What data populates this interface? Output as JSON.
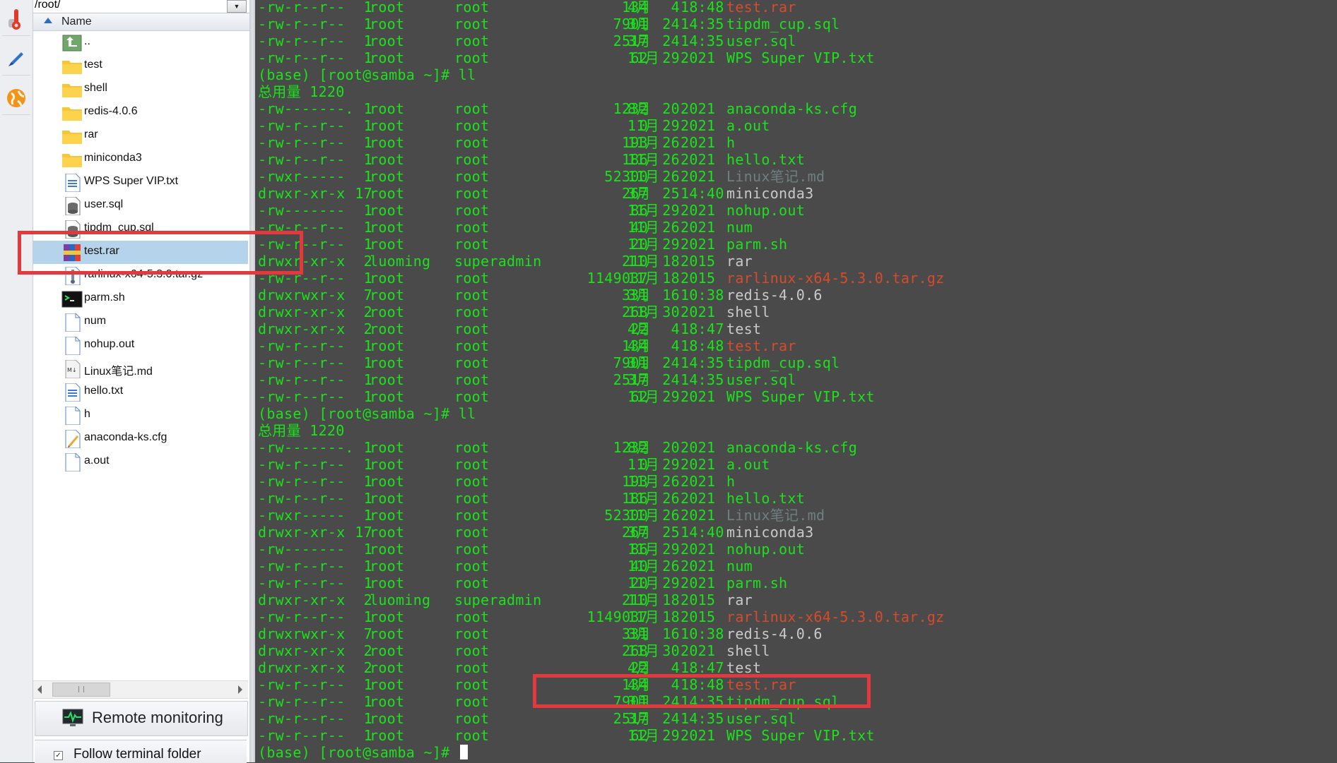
{
  "toolbar": {
    "buttons": [
      {
        "name": "thermometer-icon"
      },
      {
        "name": "pen-icon"
      },
      {
        "name": "globe-icon"
      }
    ]
  },
  "file_panel": {
    "path": "/root/",
    "column_header": "Name",
    "items": [
      {
        "name": "..",
        "icon": "parent-folder-icon"
      },
      {
        "name": "test",
        "icon": "folder-icon"
      },
      {
        "name": "shell",
        "icon": "folder-icon"
      },
      {
        "name": "redis-4.0.6",
        "icon": "folder-icon"
      },
      {
        "name": "rar",
        "icon": "folder-icon"
      },
      {
        "name": "miniconda3",
        "icon": "folder-icon"
      },
      {
        "name": "WPS Super VIP.txt",
        "icon": "text-file-icon"
      },
      {
        "name": "user.sql",
        "icon": "database-file-icon"
      },
      {
        "name": "tipdm_cup.sql",
        "icon": "database-file-icon"
      },
      {
        "name": "test.rar",
        "icon": "rar-archive-icon",
        "selected": true
      },
      {
        "name": "rarlinux-x64-5.3.0.tar.gz",
        "icon": "archive-file-icon"
      },
      {
        "name": "parm.sh",
        "icon": "shell-script-icon"
      },
      {
        "name": "num",
        "icon": "blank-file-icon"
      },
      {
        "name": "nohup.out",
        "icon": "blank-file-icon"
      },
      {
        "name": "Linux笔记.md",
        "icon": "markdown-file-icon"
      },
      {
        "name": "hello.txt",
        "icon": "text-file-icon"
      },
      {
        "name": "h",
        "icon": "blank-file-icon"
      },
      {
        "name": "anaconda-ks.cfg",
        "icon": "config-file-icon"
      },
      {
        "name": "a.out",
        "icon": "blank-file-icon"
      }
    ],
    "remote_monitoring_label": "Remote monitoring",
    "follow_terminal_label": "Follow terminal folder",
    "follow_terminal_checked": "✓"
  },
  "terminal": {
    "prompt": "(base) [root@samba ~]# ",
    "command": "ll",
    "total_line": "总用量 1220",
    "top_rows": [
      {
        "perm": "-rw-r--r--",
        "links": "1",
        "owner": "root",
        "group": "root",
        "size": "134",
        "month": "4月",
        "day": "4",
        "time": "18:48",
        "name": "test.rar",
        "color": "red"
      },
      {
        "perm": "-rw-r--r--",
        "links": "1",
        "owner": "root",
        "group": "root",
        "size": "7901",
        "month": "3月",
        "day": "24",
        "time": "14:35",
        "name": "tipdm_cup.sql",
        "color": "green"
      },
      {
        "perm": "-rw-r--r--",
        "links": "1",
        "owner": "root",
        "group": "root",
        "size": "2517",
        "month": "3月",
        "day": "24",
        "time": "14:35",
        "name": "user.sql",
        "color": "green"
      },
      {
        "perm": "-rw-r--r--",
        "links": "1",
        "owner": "root",
        "group": "root",
        "size": "62",
        "month": "11月",
        "day": "29",
        "time": "2021",
        "name": "WPS Super VIP.txt",
        "color": "green"
      }
    ],
    "listing": [
      {
        "perm": "-rw-------.",
        "links": "1",
        "owner": "root",
        "group": "root",
        "size": "1232",
        "month": "8月",
        "day": "20",
        "time": "2021",
        "name": "anaconda-ks.cfg",
        "color": "green"
      },
      {
        "perm": "-rw-r--r--",
        "links": "1",
        "owner": "root",
        "group": "root",
        "size": "0",
        "month": "11月",
        "day": "29",
        "time": "2021",
        "name": "a.out",
        "color": "green"
      },
      {
        "perm": "-rw-r--r--",
        "links": "1",
        "owner": "root",
        "group": "root",
        "size": "193",
        "month": "11月",
        "day": "26",
        "time": "2021",
        "name": "h",
        "color": "green"
      },
      {
        "perm": "-rw-r--r--",
        "links": "1",
        "owner": "root",
        "group": "root",
        "size": "186",
        "month": "11月",
        "day": "26",
        "time": "2021",
        "name": "hello.txt",
        "color": "green"
      },
      {
        "perm": "-rwxr-----",
        "links": "1",
        "owner": "root",
        "group": "root",
        "size": "52300",
        "month": "11月",
        "day": "26",
        "time": "2021",
        "name": "Linux笔记.md",
        "color": "dim"
      },
      {
        "perm": "drwxr-xr-x",
        "links": "17",
        "owner": "root",
        "group": "root",
        "size": "267",
        "month": "3月",
        "day": "25",
        "time": "14:40",
        "name": "miniconda3",
        "color": "gray"
      },
      {
        "perm": "-rw-------",
        "links": "1",
        "owner": "root",
        "group": "root",
        "size": "86",
        "month": "11月",
        "day": "29",
        "time": "2021",
        "name": "nohup.out",
        "color": "green"
      },
      {
        "perm": "-rw-r--r--",
        "links": "1",
        "owner": "root",
        "group": "root",
        "size": "40",
        "month": "11月",
        "day": "26",
        "time": "2021",
        "name": "num",
        "color": "green"
      },
      {
        "perm": "-rw-r--r--",
        "links": "1",
        "owner": "root",
        "group": "root",
        "size": "20",
        "month": "11月",
        "day": "29",
        "time": "2021",
        "name": "parm.sh",
        "color": "green"
      },
      {
        "perm": "drwxr-xr-x",
        "links": "2",
        "owner": "luoming",
        "group": "superadmin",
        "size": "210",
        "month": "11月",
        "day": "18",
        "time": "2015",
        "name": "rar",
        "color": "gray"
      },
      {
        "perm": "-rw-r--r--",
        "links": "1",
        "owner": "root",
        "group": "root",
        "size": "1149037",
        "month": "11月",
        "day": "18",
        "time": "2015",
        "name": "rarlinux-x64-5.3.0.tar.gz",
        "color": "red"
      },
      {
        "perm": "drwxrwxr-x",
        "links": "7",
        "owner": "root",
        "group": "root",
        "size": "331",
        "month": "3月",
        "day": "16",
        "time": "10:38",
        "name": "redis-4.0.6",
        "color": "gray"
      },
      {
        "perm": "drwxr-xr-x",
        "links": "2",
        "owner": "root",
        "group": "root",
        "size": "268",
        "month": "11月",
        "day": "30",
        "time": "2021",
        "name": "shell",
        "color": "gray"
      },
      {
        "perm": "drwxr-xr-x",
        "links": "2",
        "owner": "root",
        "group": "root",
        "size": "22",
        "month": "4月",
        "day": "4",
        "time": "18:47",
        "name": "test",
        "color": "gray"
      },
      {
        "perm": "-rw-r--r--",
        "links": "1",
        "owner": "root",
        "group": "root",
        "size": "134",
        "month": "4月",
        "day": "4",
        "time": "18:48",
        "name": "test.rar",
        "color": "red"
      },
      {
        "perm": "-rw-r--r--",
        "links": "1",
        "owner": "root",
        "group": "root",
        "size": "7901",
        "month": "3月",
        "day": "24",
        "time": "14:35",
        "name": "tipdm_cup.sql",
        "color": "green"
      },
      {
        "perm": "-rw-r--r--",
        "links": "1",
        "owner": "root",
        "group": "root",
        "size": "2517",
        "month": "3月",
        "day": "24",
        "time": "14:35",
        "name": "user.sql",
        "color": "green"
      },
      {
        "perm": "-rw-r--r--",
        "links": "1",
        "owner": "root",
        "group": "root",
        "size": "62",
        "month": "11月",
        "day": "29",
        "time": "2021",
        "name": "WPS Super VIP.txt",
        "color": "green"
      }
    ],
    "listing_repeats": 2
  },
  "colors": {
    "terminal_bg": "#4a4a4a",
    "terminal_green": "#18e418",
    "archive_red": "#d84a2a",
    "directory_gray": "#c9c9c9",
    "selection_blue": "#b5d3ea",
    "highlight_box": "#e4393c"
  }
}
